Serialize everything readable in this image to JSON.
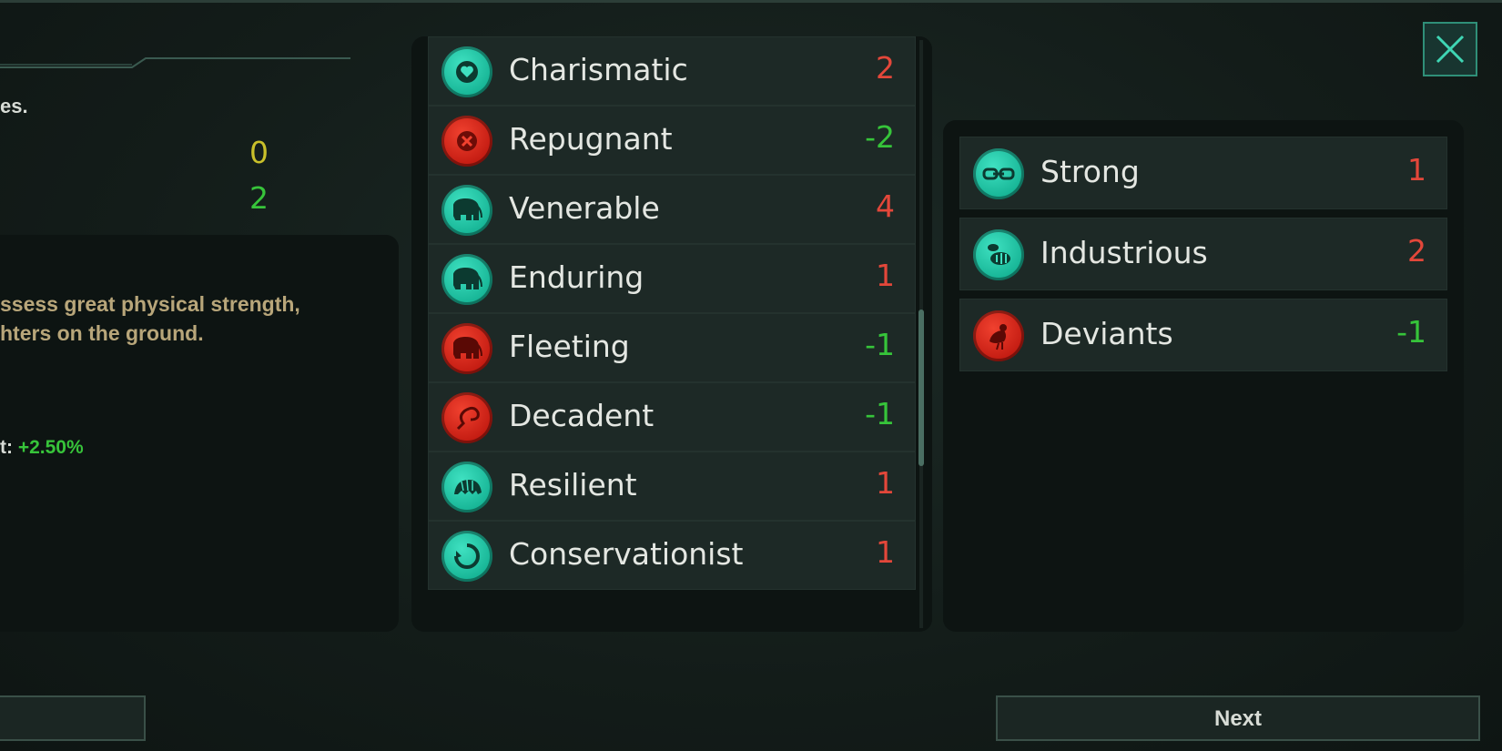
{
  "left": {
    "text_fragment": "es.",
    "values": [
      "0",
      "2"
    ],
    "description_lines": [
      "ssess great physical strength,",
      "hters on the ground."
    ],
    "bonus_label": "t:",
    "bonus_value": "+2.50%"
  },
  "traits": [
    {
      "name": "Charismatic",
      "cost": "2",
      "color": "teal",
      "cost_color": "red",
      "icon": "heart-icon"
    },
    {
      "name": "Repugnant",
      "cost": "-2",
      "color": "red",
      "cost_color": "green",
      "icon": "x-icon"
    },
    {
      "name": "Venerable",
      "cost": "4",
      "color": "teal",
      "cost_color": "red",
      "icon": "elephant-icon"
    },
    {
      "name": "Enduring",
      "cost": "1",
      "color": "teal",
      "cost_color": "red",
      "icon": "elephant-icon"
    },
    {
      "name": "Fleeting",
      "cost": "-1",
      "color": "red",
      "cost_color": "green",
      "icon": "elephant-icon"
    },
    {
      "name": "Decadent",
      "cost": "-1",
      "color": "red",
      "cost_color": "green",
      "icon": "whip-icon"
    },
    {
      "name": "Resilient",
      "cost": "1",
      "color": "teal",
      "cost_color": "red",
      "icon": "armadillo-icon"
    },
    {
      "name": "Conservationist",
      "cost": "1",
      "color": "teal",
      "cost_color": "red",
      "icon": "recycle-icon"
    }
  ],
  "selected_traits": [
    {
      "name": "Strong",
      "cost": "1",
      "color": "teal",
      "cost_color": "red",
      "icon": "chain-icon"
    },
    {
      "name": "Industrious",
      "cost": "2",
      "color": "teal",
      "cost_color": "red",
      "icon": "bee-icon"
    },
    {
      "name": "Deviants",
      "cost": "-1",
      "color": "red",
      "cost_color": "green",
      "icon": "bird-icon"
    }
  ],
  "buttons": {
    "next": "Next",
    "back": ""
  },
  "colors": {
    "teal": "#17b596",
    "red": "#c41c12",
    "cost_red": "#e3473a",
    "cost_green": "#36c43a",
    "yellow": "#c9c02a"
  }
}
